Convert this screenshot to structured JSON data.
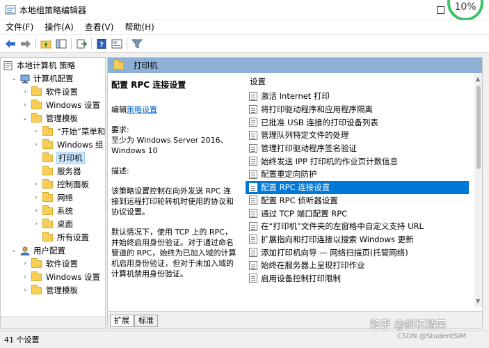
{
  "window": {
    "title": "本地组策略编辑器",
    "badge_text": "10%"
  },
  "menu": [
    "文件(F)",
    "操作(A)",
    "查看(V)",
    "帮助(H)"
  ],
  "tree": {
    "root": "本地计算机 策略",
    "computer_config": "计算机配置",
    "cc_software": "软件设置",
    "cc_windows": "Windows 设置",
    "cc_admin": "管理模板",
    "admin_start": "“开始”菜单和",
    "admin_windows": "Windows 组",
    "admin_printers": "打印机",
    "admin_server": "服务器",
    "admin_control": "控制面板",
    "admin_network": "网络",
    "admin_system": "系统",
    "admin_desktop": "桌面",
    "admin_all": "所有设置",
    "user_config": "用户配置",
    "uc_software": "软件设置",
    "uc_windows": "Windows 设置",
    "uc_admin": "管理模板"
  },
  "panel": {
    "header": "打印机",
    "selected_title": "配置 RPC 连接设置",
    "edit_prefix": "编辑",
    "edit_link": "策略设置",
    "req_label": "要求:",
    "req_text": "至少为 Windows Server 2016、Windows 10",
    "desc_label": "描述:",
    "desc_p1": "该策略设置控制在向外发送 RPC 连接到远程打印轮转机时使用的协议和协议设置。",
    "desc_p2": "默认情况下，使用 TCP 上的 RPC，并始终启用身份验证。对于通过命名管道的 RPC，始终为已加入域的计算机启用身份验证，但对于未加入域的计算机禁用身份验证。"
  },
  "list": {
    "header": "设置",
    "items": [
      "激活 Internet 打印",
      "将打印驱动程序和应用程序隔离",
      "已批准 USB 连接的打印设备列表",
      "管理队列特定文件的处理",
      "管理打印驱动程序签名验证",
      "始终发送 IPP 打印机的作业页计数信息",
      "配置重定向防护",
      "配置 RPC 连接设置",
      "配置 RPC 侦听器设置",
      "通过 TCP 端口配置 RPC",
      "在“打印机”文件夹的左窗格中自定义支持 URL",
      "扩展指向和打印连接以搜索 Windows 更新",
      "添加打印机向导 — 网络扫描页(托管网络)",
      "始终在服务器上呈现打印作业",
      "启用设备控制打印限制"
    ],
    "selected_index": 7
  },
  "tabs": [
    "扩展",
    "标准"
  ],
  "status": "41 个设置",
  "watermark": {
    "main": "知乎 @斜杠精英",
    "sub": "CSDN @StudentSIM"
  }
}
